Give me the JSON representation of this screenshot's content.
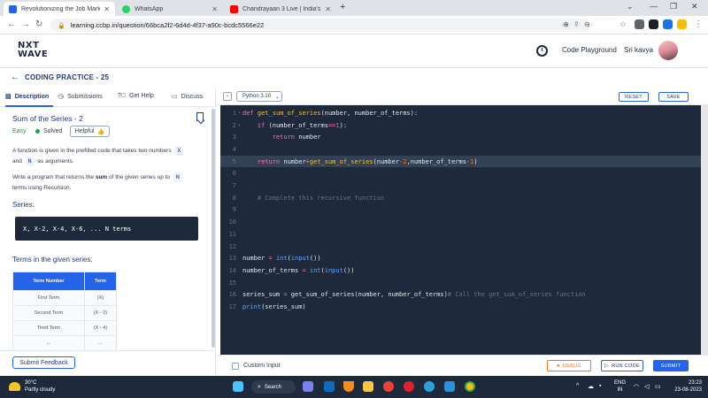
{
  "browser": {
    "tabs": [
      {
        "title": "Revolutionizing the Job Market |",
        "favicon_color": "#2563eb",
        "active": true
      },
      {
        "title": "WhatsApp",
        "favicon_color": "#25d366",
        "active": false
      },
      {
        "title": "Chandrayaan 3 Live | India's Cha",
        "favicon_color": "#ff0000",
        "active": false
      }
    ],
    "url": "learning.ccbp.in/question/66bca2f2-6d4d-4f37-a90c-bcdc5566e22"
  },
  "header": {
    "logo_line1": "NXT",
    "logo_line2": "WAVE",
    "code_playground": "Code Playground",
    "user_name": "Sri kavya"
  },
  "practice_title": "CODING PRACTICE - 25",
  "left_tabs": [
    {
      "label": "Description",
      "icon": "document-icon"
    },
    {
      "label": "Submissions",
      "icon": "clock-icon"
    },
    {
      "label": "Get Help",
      "icon": "help-icon"
    },
    {
      "label": "Discuss",
      "icon": "chat-icon"
    }
  ],
  "question": {
    "title": "Sum of the Series - 2",
    "difficulty": "Easy",
    "status": "Solved",
    "helpful_label": "Helpful",
    "para1_a": "A function is given in the prefilled code that takes two numbers",
    "para1_chip1": "X",
    "para1_b": "and",
    "para1_chip2": "N",
    "para1_c": "as arguments.",
    "para2_a": "Write a program that returns the",
    "para2_bold": "sum",
    "para2_b": "of the given series up to",
    "para2_chip": "N",
    "para2_c": "terms using Recursion.",
    "series_label": "Series:",
    "series_code": "X, X-2, X-4, X-6, ... N terms",
    "terms_label": "Terms in the given series:",
    "table_headers": [
      "Term Number",
      "Term"
    ],
    "table_rows": [
      [
        "First Term",
        "(X)"
      ],
      [
        "Second Term",
        "(X - 2)"
      ],
      [
        "Third Term",
        "(X - 4)"
      ],
      [
        "...",
        "..."
      ]
    ],
    "feedback_label": "Submit Feedback"
  },
  "editor": {
    "language": "Python 3.10",
    "reset_label": "RESET",
    "save_label": "SAVE",
    "custom_input_label": "Custom Input",
    "debug_label": "DEBUG",
    "run_label": "RUN CODE",
    "submit_label": "SUBMIT",
    "line_numbers": [
      "1",
      "2",
      "3",
      "4",
      "5",
      "6",
      "7",
      "8",
      "9",
      "10",
      "11",
      "12",
      "13",
      "14",
      "15",
      "16",
      "17"
    ],
    "highlighted_line": 5
  },
  "taskbar": {
    "temperature": "30°C",
    "weather": "Partly cloudy",
    "search_label": "Search",
    "lang1": "ENG",
    "lang2": "IN",
    "time": "23:23",
    "date": "23-08-2023"
  }
}
